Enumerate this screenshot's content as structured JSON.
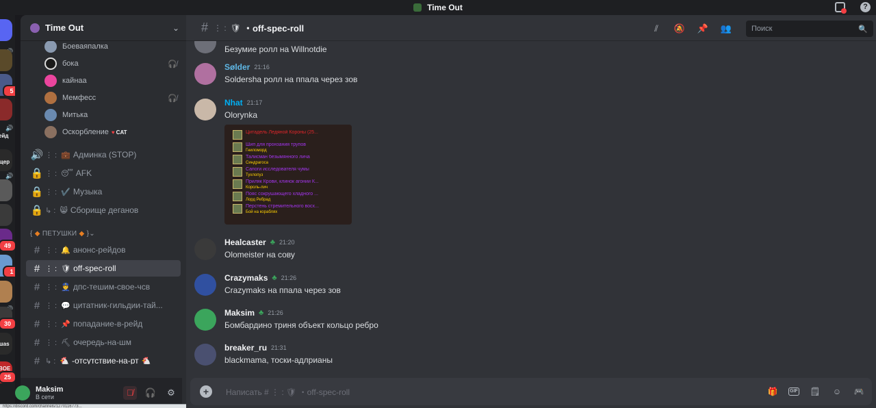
{
  "window": {
    "title": "Time Out"
  },
  "rail": {
    "badges": [
      "5",
      "49",
      "1",
      "30",
      "25"
    ],
    "labels": [
      "ейд",
      "щер",
      "шаs",
      "BOE"
    ]
  },
  "server": {
    "name": "Time Out"
  },
  "voice_users": [
    {
      "name": "Боеваяпалка",
      "muted": false,
      "tag": ""
    },
    {
      "name": "бока",
      "muted": true,
      "tag": ""
    },
    {
      "name": "кайнаа",
      "muted": false,
      "tag": ""
    },
    {
      "name": "Мемфесс",
      "muted": true,
      "tag": ""
    },
    {
      "name": "Митька",
      "muted": false,
      "tag": ""
    },
    {
      "name": "Оскорбление",
      "muted": false,
      "tag": "CAT"
    }
  ],
  "channels_top": [
    {
      "prefix": "🔊",
      "emoji": "💼",
      "label": "Админка (STOP)"
    },
    {
      "prefix": "🔒",
      "emoji": "😴",
      "label": "AFK"
    },
    {
      "prefix": "🔒",
      "emoji": "✔️",
      "label": "Музыка"
    },
    {
      "prefix": "🔒",
      "emoji": "😸",
      "label": "Сборище деганов"
    }
  ],
  "category": {
    "label": "ПЕТУШКИ"
  },
  "channels": [
    {
      "emoji": "🔔",
      "label": "анонс-рейдов",
      "active": false
    },
    {
      "emoji": "🛡",
      "label": "off-spec-roll",
      "active": true
    },
    {
      "emoji": "👮",
      "label": "дпс-тешим-свое-чсв",
      "active": false
    },
    {
      "emoji": "💬",
      "label": "цитатник-гильдии-тай...",
      "active": false
    },
    {
      "emoji": "📌",
      "label": "попадание-в-рейд",
      "active": false
    },
    {
      "emoji": "⛏",
      "label": "очередь-на-шм",
      "active": false
    },
    {
      "emoji": "🐔",
      "label": "-отсутствие-на-рт",
      "active": false
    }
  ],
  "user": {
    "name": "Maksim",
    "status": "В сети"
  },
  "url_hint": "https://discord.com/channels/1270116773...",
  "header": {
    "channel": "off-spec-roll",
    "search_placeholder": "Поиск"
  },
  "messages": [
    {
      "author": "",
      "time": "",
      "text": "Безумие ролл на Willnotdie",
      "color": "#dbdee1"
    },
    {
      "author": "Sølder",
      "time": "21:16",
      "text": "Soldersha ролл  на ппала через зов",
      "color": "#5fb8e6"
    },
    {
      "author": "Nhat",
      "time": "21:17",
      "text": "Olorynka",
      "color": "#00b0f4"
    },
    {
      "author": "Healcaster",
      "time": "21:20",
      "text": "Olomeister на сову",
      "color": "#f2f3f5"
    },
    {
      "author": "Crazymaks",
      "time": "21:26",
      "text": "Crazymaks на ппала через зов",
      "color": "#f2f3f5"
    },
    {
      "author": "Maksim",
      "time": "21:26",
      "text": "Бомбардино триня объект кольцо ребро",
      "color": "#f2f3f5"
    },
    {
      "author": "breaker_ru",
      "time": "21:31",
      "text": "blackmama, тоски-адлрианы",
      "color": "#f2f3f5"
    }
  ],
  "embed_items": [
    {
      "name": "Цитадель Ледяной Короны (25...",
      "source": ""
    },
    {
      "name": "Шип для пронзания трупов",
      "source": "Гниломорд"
    },
    {
      "name": "Талисман безымянного лича",
      "source": "Синдрагоса"
    },
    {
      "name": "Сапоги исследователя чумы",
      "source": "Тухлопуз"
    },
    {
      "name": "Приляк Крови, клинок агонии К...",
      "source": "Король-лич"
    },
    {
      "name": "Пояс сокрушающего хладного ...",
      "source": "Лорд Ребрад"
    },
    {
      "name": "Перстень стремительного восх...",
      "source": "Бой на кораблях"
    }
  ],
  "composer": {
    "placeholder": "Написать #  ⋮ :  🛡 ・off-spec-roll"
  }
}
